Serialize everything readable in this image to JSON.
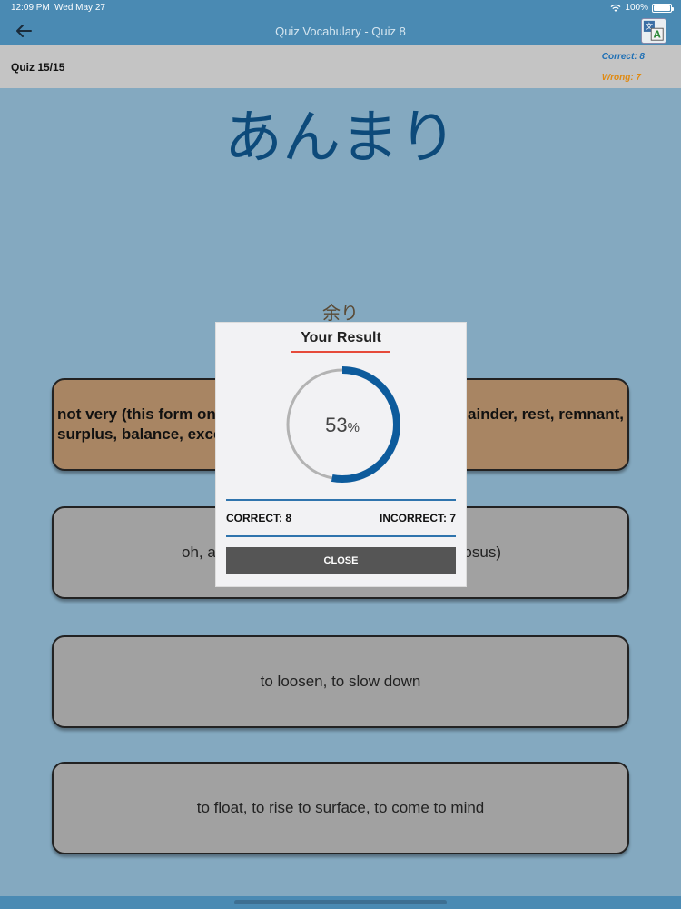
{
  "status": {
    "time": "12:09 PM",
    "date": "Wed May 27",
    "battery": "100%"
  },
  "nav": {
    "title": "Quiz Vocabulary - Quiz 8"
  },
  "info": {
    "quiz_count": "Quiz 15/15",
    "correct": "Correct: 8",
    "wrong": "Wrong: 7"
  },
  "question": {
    "word": "あんまり",
    "kanji": "余り"
  },
  "answers": [
    {
      "line1": "not very (this form on... ...ainder, rest, remnant,",
      "line1_left": "not very (this form on",
      "line1_right": "ainder, rest, remnant,",
      "line2": "surplus, balance, exce"
    },
    {
      "left": "oh, al",
      "right": "osus)"
    },
    {
      "text": "to loosen, to slow down"
    },
    {
      "text": "to float, to rise to surface, to come to mind"
    }
  ],
  "result": {
    "title": "Your Result",
    "percent": 53,
    "percent_number": "53",
    "percent_sign": "%",
    "correct_label": "CORRECT: 8",
    "incorrect_label": "INCORRECT: 7",
    "close_label": "CLOSE"
  },
  "colors": {
    "accent_blue": "#0d5b9c",
    "ring_track": "#b3b3b3",
    "title_underline": "#e64a3a"
  },
  "icons": {
    "back": "arrow-left-icon",
    "translate": "translate-icon",
    "wifi": "wifi-icon",
    "battery": "battery-icon"
  }
}
